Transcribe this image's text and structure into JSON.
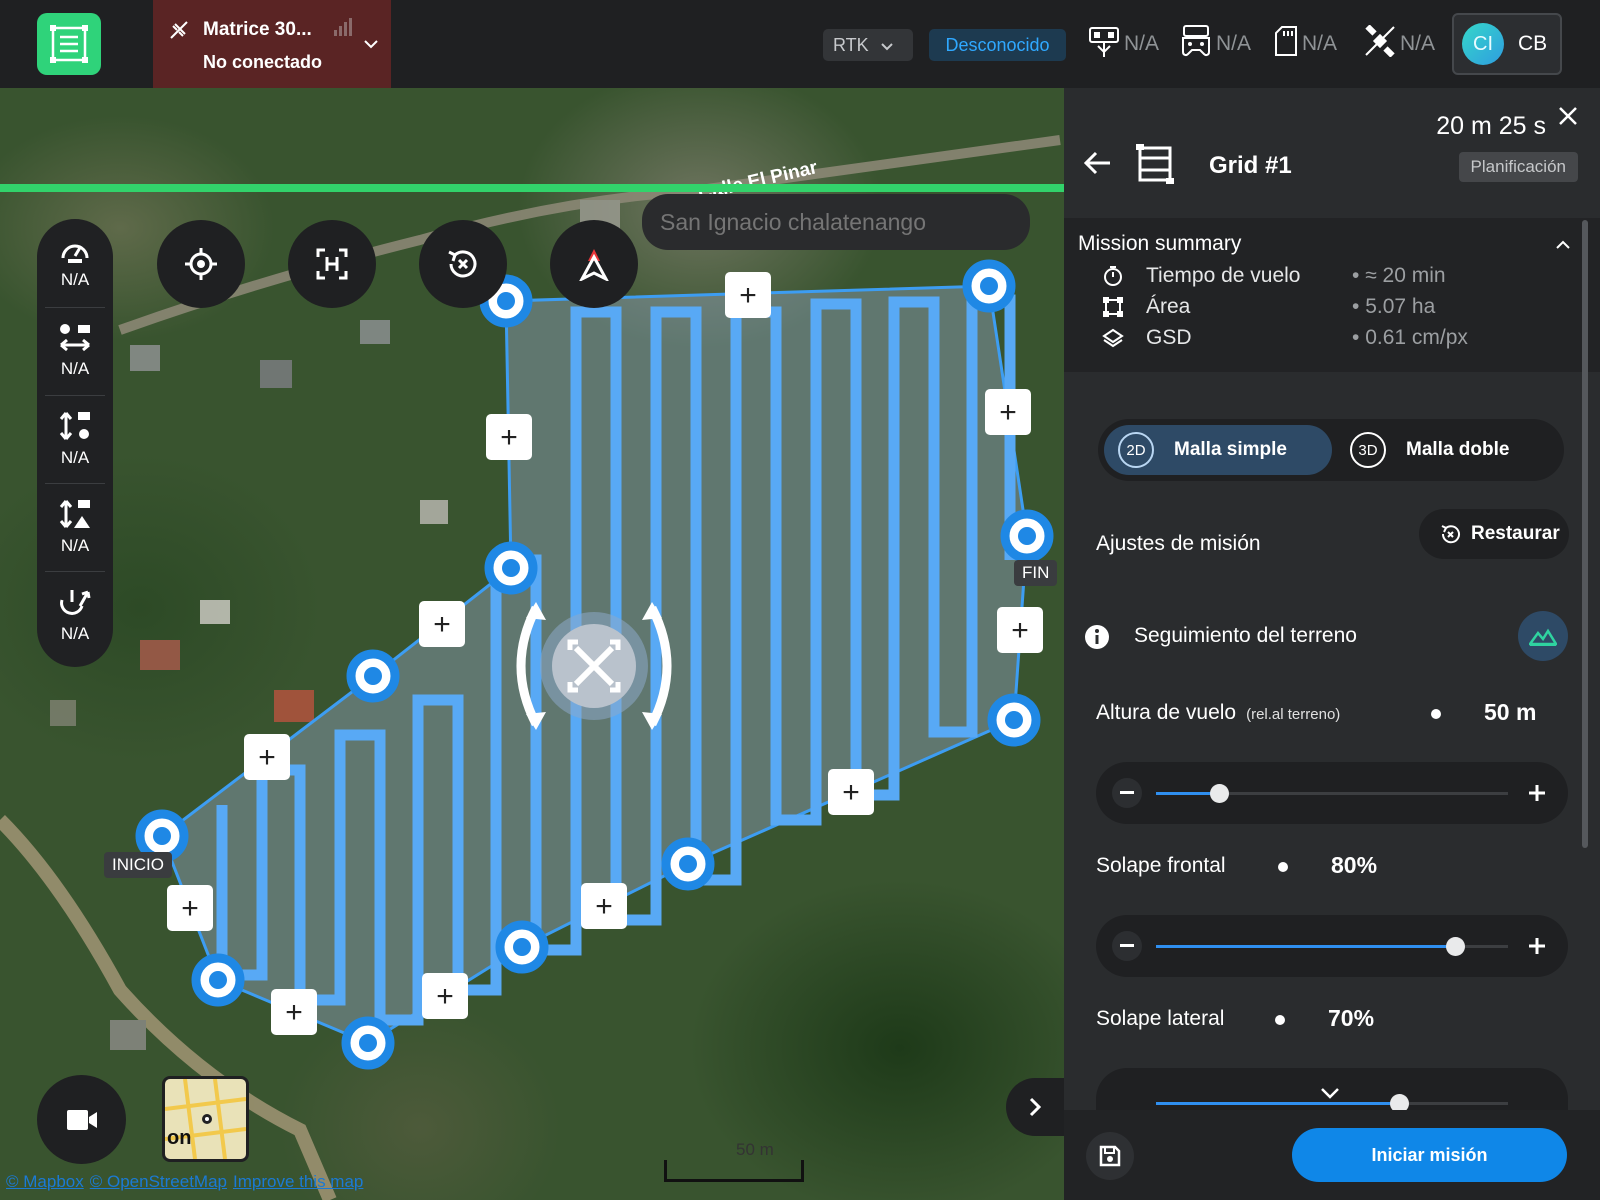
{
  "topbar": {
    "device_name": "Matrice 30...",
    "device_status": "No conectado",
    "rtk_label": "RTK",
    "connection_status": "Desconocido",
    "stats": [
      {
        "icon": "drone-remote-icon",
        "value": "N/A"
      },
      {
        "icon": "gamepad-icon",
        "value": "N/A"
      },
      {
        "icon": "sd-card-icon",
        "value": "N/A"
      },
      {
        "icon": "satellite-icon",
        "value": "N/A"
      }
    ],
    "user_avatar": "CI",
    "user_initials": "CB",
    "colors": {
      "logo": "#2fd37a",
      "device_bg": "#5a2424",
      "status_text": "#2fa8ff"
    }
  },
  "map": {
    "search_placeholder": "San Ignacio chalatenango",
    "progress": 1.0,
    "start_label": "INICIO",
    "end_label": "FIN",
    "street_label": "Calle El Pinar",
    "scale_label": "50 m",
    "minimap_text": "on",
    "credits": [
      "© Mapbox",
      "© OpenStreetMap",
      "Improve this map"
    ],
    "left_tools": [
      {
        "icon": "speedometer-icon",
        "value": "N/A"
      },
      {
        "icon": "horizontal-distance-icon",
        "value": "N/A"
      },
      {
        "icon": "vertical-distance-icon",
        "value": "N/A"
      },
      {
        "icon": "altitude-icon",
        "value": "N/A"
      },
      {
        "icon": "battery-return-icon",
        "value": "N/A"
      }
    ]
  },
  "panel": {
    "duration": "20 m 25 s",
    "phase": "Planificación",
    "title": "Grid #1",
    "summary": {
      "title": "Mission summary",
      "rows": [
        {
          "icon": "timer-icon",
          "label": "Tiempo de vuelo",
          "value": "≈ 20 min"
        },
        {
          "icon": "area-icon",
          "label": "Área",
          "value": "5.07 ha"
        },
        {
          "icon": "layers-icon",
          "label": "GSD",
          "value": "0.61 cm/px"
        }
      ]
    },
    "grid_modes": [
      {
        "badge": "2D",
        "label": "Malla simple",
        "selected": true
      },
      {
        "badge": "3D",
        "label": "Malla doble",
        "selected": false
      }
    ],
    "settings_label": "Ajustes de misión",
    "reset_label": "Restaurar",
    "terrain_label": "Seguimiento del terreno",
    "altitude": {
      "label": "Altura de vuelo",
      "sub": "(rel.al terreno)",
      "value": "50 m",
      "fraction": 0.18
    },
    "front_overlap": {
      "label": "Solape frontal",
      "value": "80%",
      "fraction": 0.85
    },
    "side_overlap": {
      "label": "Solape lateral",
      "value": "70%",
      "fraction": 0.69
    },
    "start_button": "Iniciar misión"
  }
}
